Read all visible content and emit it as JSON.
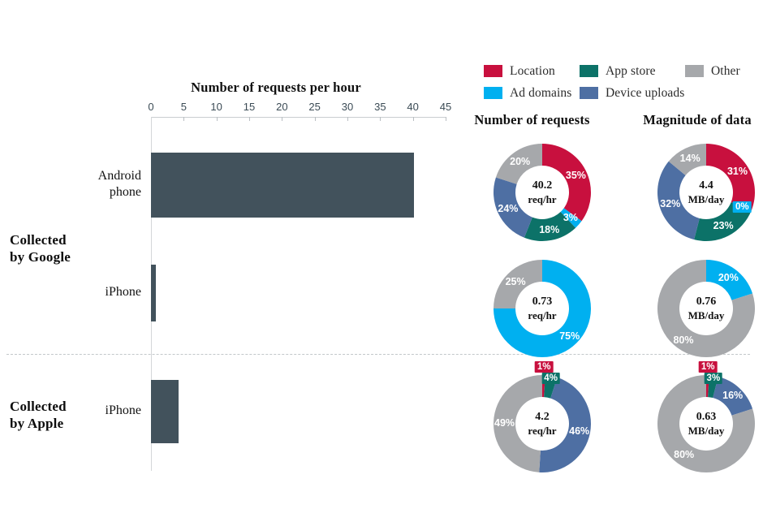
{
  "legend": {
    "items": [
      {
        "label": "Location",
        "color": "#c8103e",
        "row": 0,
        "col": 0
      },
      {
        "label": "App store",
        "color": "#0c7268",
        "row": 0,
        "col": 1
      },
      {
        "label": "Other",
        "color": "#a6a8ab",
        "row": 0,
        "col": 2
      },
      {
        "label": "Ad domains",
        "color": "#00b0f0",
        "row": 1,
        "col": 0
      },
      {
        "label": "Device uploads",
        "color": "#4e6fa3",
        "row": 1,
        "col": 1
      }
    ]
  },
  "columns": {
    "requests_header": "Number of requests",
    "magnitude_header": "Magnitude of data"
  },
  "groups": [
    {
      "label": "Collected\nby Google",
      "line1": "Collected",
      "line2": "by Google"
    },
    {
      "label": "Collected\nby Apple",
      "line1": "Collected",
      "line2": "by Apple"
    }
  ],
  "chart_data": [
    {
      "type": "bar",
      "title": "Number of requests per hour",
      "orientation": "horizontal",
      "xlabel": "Number of requests per hour",
      "ylabel": "",
      "xlim": [
        0,
        45
      ],
      "xticks": [
        0,
        5,
        10,
        15,
        20,
        25,
        30,
        35,
        40,
        45
      ],
      "grid": false,
      "bar_color": "#42525c",
      "categories": [
        "Android phone",
        "iPhone",
        "iPhone"
      ],
      "group_of_category": [
        "Collected by Google",
        "Collected by Google",
        "Collected by Apple"
      ],
      "values": [
        40.2,
        0.73,
        4.2
      ]
    },
    {
      "type": "pie",
      "title": "Number of requests",
      "subtitle": "Android phone — Collected by Google",
      "center_value": "40.2",
      "center_unit": "req/hr",
      "labels": [
        "Location",
        "Ad domains",
        "App store",
        "Device uploads",
        "Other"
      ],
      "values": [
        35,
        3,
        18,
        24,
        20
      ],
      "value_labels": [
        "35%",
        "3%",
        "18%",
        "24%",
        "20%"
      ],
      "colors": [
        "#c8103e",
        "#00b0f0",
        "#0c7268",
        "#4e6fa3",
        "#a6a8ab"
      ]
    },
    {
      "type": "pie",
      "title": "Magnitude of data",
      "subtitle": "Android phone — Collected by Google",
      "center_value": "4.4",
      "center_unit": "MB/day",
      "labels": [
        "Location",
        "Ad domains",
        "App store",
        "Device uploads",
        "Other"
      ],
      "values": [
        31,
        0,
        23,
        32,
        14
      ],
      "value_labels": [
        "31%",
        "0%",
        "23%",
        "32%",
        "14%"
      ],
      "colors": [
        "#c8103e",
        "#00b0f0",
        "#0c7268",
        "#4e6fa3",
        "#a6a8ab"
      ]
    },
    {
      "type": "pie",
      "title": "Number of requests",
      "subtitle": "iPhone — Collected by Google",
      "center_value": "0.73",
      "center_unit": "req/hr",
      "labels": [
        "Ad domains",
        "Other"
      ],
      "values": [
        75,
        25
      ],
      "value_labels": [
        "75%",
        "25%"
      ],
      "colors": [
        "#00b0f0",
        "#a6a8ab"
      ]
    },
    {
      "type": "pie",
      "title": "Magnitude of data",
      "subtitle": "iPhone — Collected by Google",
      "center_value": "0.76",
      "center_unit": "MB/day",
      "labels": [
        "Ad domains",
        "Other"
      ],
      "values": [
        20,
        80
      ],
      "value_labels": [
        "20%",
        "80%"
      ],
      "colors": [
        "#00b0f0",
        "#a6a8ab"
      ]
    },
    {
      "type": "pie",
      "title": "Number of requests",
      "subtitle": "iPhone — Collected by Apple",
      "center_value": "4.2",
      "center_unit": "req/hr",
      "labels": [
        "Location",
        "App store",
        "Device uploads",
        "Other"
      ],
      "values": [
        1,
        4,
        46,
        49
      ],
      "value_labels": [
        "1%",
        "4%",
        "46%",
        "49%"
      ],
      "colors": [
        "#c8103e",
        "#0c7268",
        "#4e6fa3",
        "#a6a8ab"
      ]
    },
    {
      "type": "pie",
      "title": "Magnitude of data",
      "subtitle": "iPhone — Collected by Apple",
      "center_value": "0.63",
      "center_unit": "MB/day",
      "labels": [
        "Location",
        "App store",
        "Device uploads",
        "Other"
      ],
      "values": [
        1,
        3,
        16,
        80
      ],
      "value_labels": [
        "1%",
        "3%",
        "16%",
        "80%"
      ],
      "colors": [
        "#c8103e",
        "#0c7268",
        "#4e6fa3",
        "#a6a8ab"
      ]
    }
  ]
}
